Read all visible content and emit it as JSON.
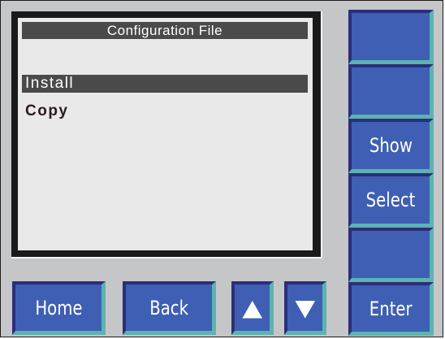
{
  "screen": {
    "title": "Configuration File",
    "menu": [
      {
        "label": "Install",
        "selected": true
      },
      {
        "label": "Copy",
        "selected": false
      }
    ]
  },
  "side_buttons": {
    "show_label": "Show",
    "select_label": "Select",
    "enter_label": "Enter"
  },
  "bottom_buttons": {
    "home_label": "Home",
    "back_label": "Back",
    "up_icon": "arrow-up-icon",
    "down_icon": "arrow-down-icon"
  },
  "colors": {
    "button": "#3f5fb4",
    "button_shadow": "#2a2f78",
    "button_highlight": "#5db3b2",
    "panel": "#c4c6c8",
    "screen": "#e9e9e9",
    "selection": "#4a4a4a"
  }
}
